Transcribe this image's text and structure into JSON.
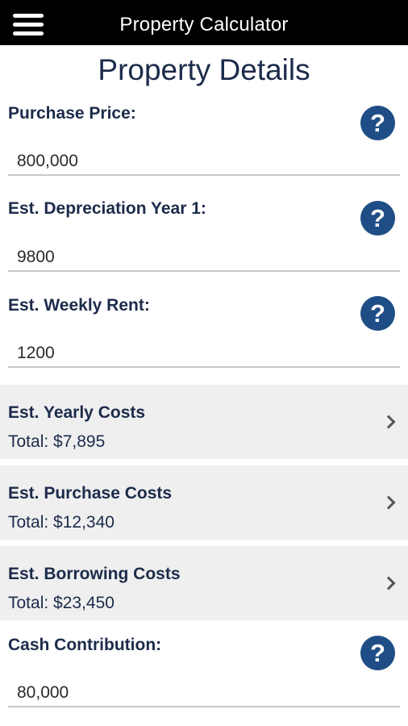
{
  "app": {
    "title": "Property Calculator",
    "menu_icon": "hamburger-menu-icon"
  },
  "page": {
    "title": "Property Details"
  },
  "fields": {
    "purchase_price": {
      "label": "Purchase Price:",
      "value": "800,000",
      "help_icon": "?"
    },
    "depreciation": {
      "label": "Est. Depreciation Year 1:",
      "value": "9800",
      "help_icon": "?"
    },
    "weekly_rent": {
      "label": "Est. Weekly Rent:",
      "value": "1200",
      "help_icon": "?"
    },
    "cash_contribution": {
      "label": "Cash Contribution:",
      "value": "80,000",
      "help_icon": "?"
    }
  },
  "sections": {
    "yearly_costs": {
      "title": "Est. Yearly Costs",
      "total": "Total: $7,895"
    },
    "purchase_costs": {
      "title": "Est. Purchase Costs",
      "total": "Total: $12,340"
    },
    "borrowing_costs": {
      "title": "Est. Borrowing Costs",
      "total": "Total: $23,450"
    }
  },
  "colors": {
    "header_bg": "#000000",
    "text": "#1c2b4a",
    "help_button": "#1f4e86",
    "section_bg": "#efefef"
  }
}
